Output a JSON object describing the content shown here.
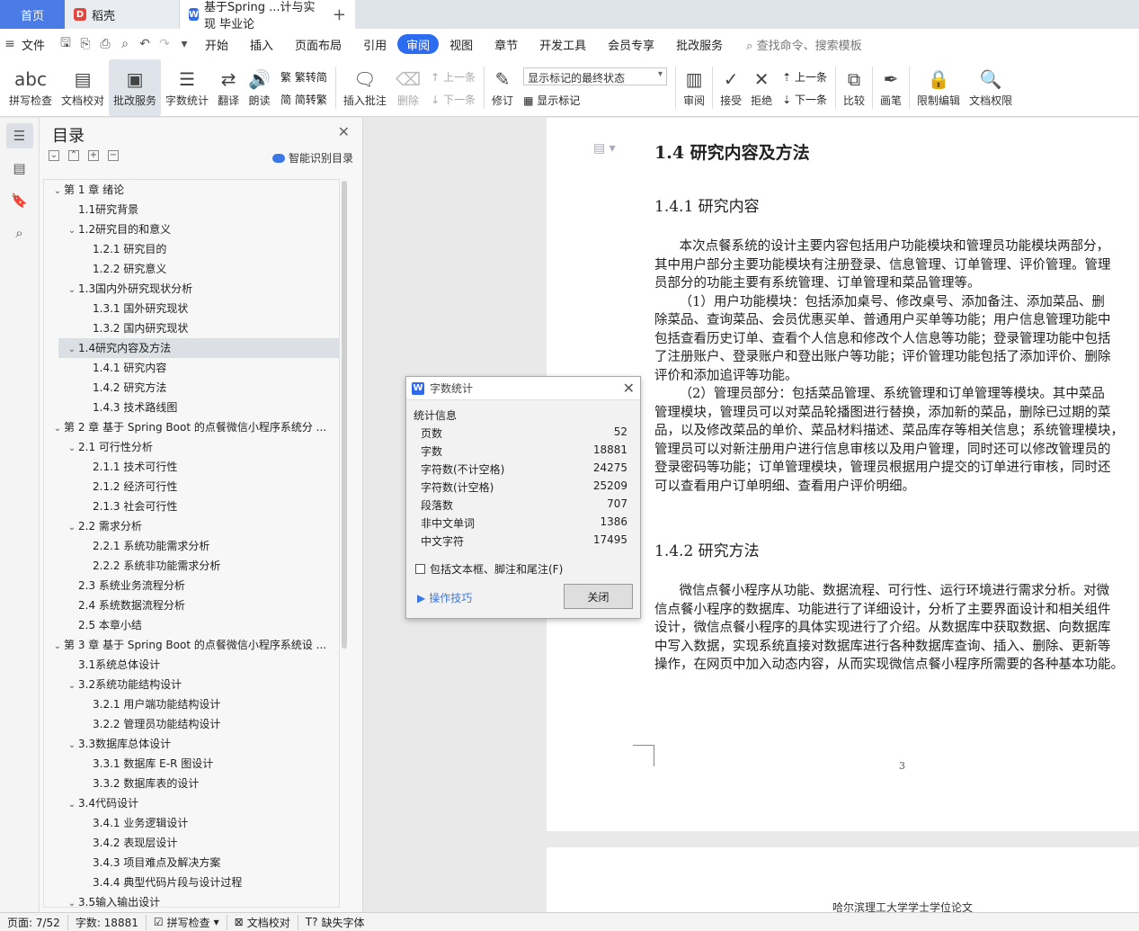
{
  "tabs": [
    {
      "label": "首页"
    },
    {
      "label": "稻壳"
    },
    {
      "label": "基于Spring ...计与实现 毕业论"
    }
  ],
  "menubar": {
    "file": "文件",
    "items": [
      "开始",
      "插入",
      "页面布局",
      "引用",
      "审阅",
      "视图",
      "章节",
      "开发工具",
      "会员专享",
      "批改服务"
    ],
    "active": "审阅",
    "search": "查找命令、搜索模板"
  },
  "ribbon": {
    "spell": "拼写检查",
    "proof": "文档校对",
    "revise_service": "批改服务",
    "word_count": "字数统计",
    "translate": "翻译",
    "read": "朗读",
    "to_traditional": "繁转简",
    "to_simplified": "简转繁",
    "insert_comment": "插入批注",
    "delete": "删除",
    "prev": "上一条",
    "next": "下一条",
    "track": "修订",
    "markup_state": "显示标记的最终状态",
    "show_markup": "显示标记",
    "review": "审阅",
    "accept": "接受",
    "reject": "拒绝",
    "prev2": "上一条",
    "next2": "下一条",
    "compare": "比较",
    "pen": "画笔",
    "restrict": "限制编辑",
    "permission": "文档权限"
  },
  "toc": {
    "title": "目录",
    "smart": "智能识别目录",
    "items": [
      {
        "label": "第 1 章  绪论",
        "level": 0,
        "car": "v"
      },
      {
        "label": "1.1研究背景",
        "level": 1,
        "car": ""
      },
      {
        "label": "1.2研究目的和意义",
        "level": 1,
        "car": "v"
      },
      {
        "label": "1.2.1 研究目的",
        "level": 2,
        "car": ""
      },
      {
        "label": "1.2.2 研究意义",
        "level": 2,
        "car": ""
      },
      {
        "label": "1.3国内外研究现状分析",
        "level": 1,
        "car": "v"
      },
      {
        "label": "1.3.1 国外研究现状",
        "level": 2,
        "car": ""
      },
      {
        "label": "1.3.2 国内研究现状",
        "level": 2,
        "car": ""
      },
      {
        "label": "1.4研究内容及方法",
        "level": 1,
        "car": "v",
        "selected": true
      },
      {
        "label": "1.4.1 研究内容",
        "level": 2,
        "car": ""
      },
      {
        "label": "1.4.2 研究方法",
        "level": 2,
        "car": ""
      },
      {
        "label": "1.4.3 技术路线图",
        "level": 2,
        "car": ""
      },
      {
        "label": "第 2 章  基于 Spring Boot 的点餐微信小程序系统分 ...",
        "level": 0,
        "car": "v"
      },
      {
        "label": "2.1 可行性分析",
        "level": 1,
        "car": "v"
      },
      {
        "label": "2.1.1 技术可行性",
        "level": 2,
        "car": ""
      },
      {
        "label": "2.1.2 经济可行性",
        "level": 2,
        "car": ""
      },
      {
        "label": "2.1.3 社会可行性",
        "level": 2,
        "car": ""
      },
      {
        "label": "2.2 需求分析",
        "level": 1,
        "car": "v"
      },
      {
        "label": "2.2.1 系统功能需求分析",
        "level": 2,
        "car": ""
      },
      {
        "label": "2.2.2 系统非功能需求分析",
        "level": 2,
        "car": ""
      },
      {
        "label": "2.3 系统业务流程分析",
        "level": 1,
        "car": ""
      },
      {
        "label": "2.4 系统数据流程分析",
        "level": 1,
        "car": ""
      },
      {
        "label": "2.5 本章小结",
        "level": 1,
        "car": ""
      },
      {
        "label": "第 3 章  基于 Spring Boot 的点餐微信小程序系统设 ...",
        "level": 0,
        "car": "v"
      },
      {
        "label": "3.1系统总体设计",
        "level": 1,
        "car": ""
      },
      {
        "label": "3.2系统功能结构设计",
        "level": 1,
        "car": "v"
      },
      {
        "label": "3.2.1 用户端功能结构设计",
        "level": 2,
        "car": ""
      },
      {
        "label": "3.2.2 管理员功能结构设计",
        "level": 2,
        "car": ""
      },
      {
        "label": "3.3数据库总体设计",
        "level": 1,
        "car": "v"
      },
      {
        "label": "3.3.1  数据库 E-R 图设计",
        "level": 2,
        "car": ""
      },
      {
        "label": "3.3.2  数据库表的设计",
        "level": 2,
        "car": ""
      },
      {
        "label": "3.4代码设计",
        "level": 1,
        "car": "v"
      },
      {
        "label": "3.4.1 业务逻辑设计",
        "level": 2,
        "car": ""
      },
      {
        "label": "3.4.2 表现层设计",
        "level": 2,
        "car": ""
      },
      {
        "label": "3.4.3 项目难点及解决方案",
        "level": 2,
        "car": ""
      },
      {
        "label": "3.4.4 典型代码片段与设计过程",
        "level": 2,
        "car": ""
      },
      {
        "label": "3.5输入输出设计",
        "level": 1,
        "car": "v"
      }
    ]
  },
  "document": {
    "h2": "1.4  研究内容及方法",
    "h3a": "1.4.1 研究内容",
    "para1": [
      "      本次点餐系统的设计主要内容包括用户功能模块和管理员功能模块两部分，",
      "其中用户部分主要功能模块有注册登录、信息管理、订单管理、评价管理。管理",
      "员部分的功能主要有系统管理、订单管理和菜品管理等。",
      "      （1）用户功能模块：包括添加桌号、修改桌号、添加备注、添加菜品、删",
      "除菜品、查询菜品、会员优惠买单、普通用户买单等功能；用户信息管理功能中",
      "包括查看历史订单、查看个人信息和修改个人信息等功能；登录管理功能中包括",
      "了注册账户、登录账户和登出账户等功能；评价管理功能包括了添加评价、删除",
      "评价和添加追评等功能。",
      "      （2）管理员部分：包括菜品管理、系统管理和订单管理等模块。其中菜品",
      "管理模块，管理员可以对菜品轮播图进行替换，添加新的菜品，删除已过期的菜",
      "品，以及修改菜品的单价、菜品材料描述、菜品库存等相关信息；系统管理模块，",
      "管理员可以对新注册用户进行信息审核以及用户管理，同时还可以修改管理员的",
      "登录密码等功能；订单管理模块，管理员根据用户提交的订单进行审核，同时还",
      "可以查看用户订单明细、查看用户评价明细。"
    ],
    "h3b": "1.4.2 研究方法",
    "para2": [
      "      微信点餐小程序从功能、数据流程、可行性、运行环境进行需求分析。对微",
      "信点餐小程序的数据库、功能进行了详细设计，分析了主要界面设计和相关组件",
      "设计，微信点餐小程序的具体实现进行了介绍。从数据库中获取数据、向数据库",
      "中写入数据，实现系统直接对数据库进行各种数据库查询、插入、删除、更新等",
      "操作，在网页中加入动态内容，从而实现微信点餐小程序所需要的各种基本功能。"
    ],
    "page_number": "3",
    "next_header": "哈尔滨理工大学学士学位论文"
  },
  "dialog": {
    "title": "字数统计",
    "section": "统计信息",
    "rows": [
      {
        "k": "页数",
        "v": "52"
      },
      {
        "k": "字数",
        "v": "18881"
      },
      {
        "k": "字符数(不计空格)",
        "v": "24275"
      },
      {
        "k": "字符数(计空格)",
        "v": "25209"
      },
      {
        "k": "段落数",
        "v": "707"
      },
      {
        "k": "非中文单词",
        "v": "1386"
      },
      {
        "k": "中文字符",
        "v": "17495"
      }
    ],
    "checkbox": "包括文本框、脚注和尾注(F)",
    "tip": "操作技巧",
    "close": "关闭"
  },
  "status": {
    "page": "页面: 7/52",
    "words": "字数: 18881",
    "spell": "拼写检查",
    "proof": "文档校对",
    "missing_font": "缺失字体"
  }
}
